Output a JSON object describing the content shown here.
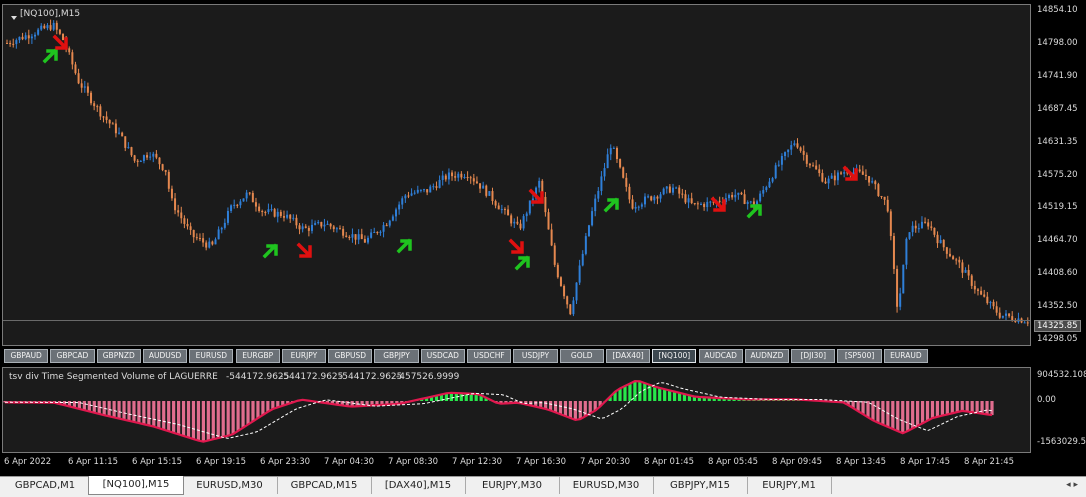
{
  "chart_title": "[NQ100],M15",
  "price_axis": {
    "labels": [
      "14854.10",
      "14798.00",
      "14741.90",
      "14687.45",
      "14631.35",
      "14575.20",
      "14519.15",
      "14464.70",
      "14408.60",
      "14352.50",
      "14298.05"
    ],
    "current_price": "14325.85",
    "ylim": [
      14298.05,
      14854.1
    ]
  },
  "symbol_buttons": [
    "GBPAUD",
    "GBPCAD",
    "GBPNZD",
    "AUDUSD",
    "EURUSD",
    "EURGBP",
    "EURJPY",
    "GBPUSD",
    "GBPJPY",
    "USDCAD",
    "USDCHF",
    "USDJPY",
    "GOLD",
    "[DAX40]",
    "[NQ100]",
    "AUDCAD",
    "AUDNZD",
    "[DJI30]",
    "[SP500]",
    "EURAUD"
  ],
  "active_symbol": "[NQ100]",
  "indicator": {
    "title": "tsv div Time Segmented Volume of LAGUERRE",
    "values": [
      "-544172.9625",
      "-544172.9625",
      "-544172.9625",
      "-457526.9999"
    ],
    "axis_labels": [
      "904532.108",
      "0.00",
      "-1563029.5"
    ]
  },
  "time_axis": [
    "6 Apr 2022",
    "6 Apr 11:15",
    "6 Apr 15:15",
    "6 Apr 19:15",
    "6 Apr 23:30",
    "7 Apr 04:30",
    "7 Apr 08:30",
    "7 Apr 12:30",
    "7 Apr 16:30",
    "7 Apr 20:30",
    "8 Apr 01:45",
    "8 Apr 05:45",
    "8 Apr 09:45",
    "8 Apr 13:45",
    "8 Apr 17:45",
    "8 Apr 21:45"
  ],
  "tabs": [
    "GBPCAD,M1",
    "[NQ100],M15",
    "EURUSD,M30",
    "GBPCAD,M15",
    "[DAX40],M15",
    "EURJPY,M30",
    "EURUSD,M30",
    "GBPJPY,M15",
    "EURJPY,M1"
  ],
  "active_tab": "[NQ100],M15",
  "colors": {
    "up": "#2f7fd8",
    "down": "#e5884f",
    "buy_arrow": "#1fc41f",
    "sell_arrow": "#e01010",
    "hist_pos": "#27e84a",
    "hist_neg": "#e06d8e",
    "line": "#e0184e"
  },
  "chart_data": {
    "type": "line",
    "price_path_x": [
      0.0,
      0.03,
      0.045,
      0.055,
      0.07,
      0.09,
      0.11,
      0.125,
      0.14,
      0.155,
      0.16,
      0.18,
      0.2,
      0.22,
      0.235,
      0.25,
      0.27,
      0.29,
      0.31,
      0.33,
      0.35,
      0.37,
      0.39,
      0.41,
      0.43,
      0.45,
      0.47,
      0.49,
      0.5,
      0.52,
      0.535,
      0.55,
      0.57,
      0.59,
      0.61,
      0.63,
      0.65,
      0.67,
      0.69,
      0.71,
      0.73,
      0.75,
      0.77,
      0.78,
      0.8,
      0.82,
      0.84,
      0.86,
      0.87,
      0.88,
      0.9,
      0.91,
      0.93,
      0.95,
      0.97,
      1.0
    ],
    "price_path_y": [
      14795,
      14815,
      14825,
      14800,
      14730,
      14680,
      14640,
      14595,
      14610,
      14580,
      14530,
      14470,
      14450,
      14520,
      14540,
      14510,
      14505,
      14480,
      14490,
      14475,
      14460,
      14490,
      14540,
      14545,
      14570,
      14575,
      14540,
      14500,
      14480,
      14560,
      14420,
      14340,
      14500,
      14625,
      14520,
      14535,
      14550,
      14520,
      14525,
      14540,
      14520,
      14580,
      14630,
      14600,
      14560,
      14580,
      14570,
      14520,
      14340,
      14480,
      14490,
      14460,
      14420,
      14370,
      14335,
      14325
    ],
    "tsv_path_x": [
      0.0,
      0.05,
      0.1,
      0.15,
      0.2,
      0.23,
      0.27,
      0.3,
      0.35,
      0.4,
      0.45,
      0.48,
      0.5,
      0.52,
      0.55,
      0.58,
      0.6,
      0.62,
      0.64,
      0.66,
      0.7,
      0.75,
      0.8,
      0.85,
      0.88,
      0.91,
      0.94,
      0.97,
      1.0
    ],
    "tsv_path_y": [
      -50000,
      -60000,
      -500000,
      -900000,
      -1450000,
      -1200000,
      -300000,
      50000,
      -200000,
      -100000,
      300000,
      250000,
      -100000,
      -60000,
      -300000,
      -700000,
      -300000,
      400000,
      750000,
      500000,
      150000,
      60000,
      60000,
      -50000,
      -700000,
      -1150000,
      -600000,
      -350000,
      -500000
    ]
  }
}
